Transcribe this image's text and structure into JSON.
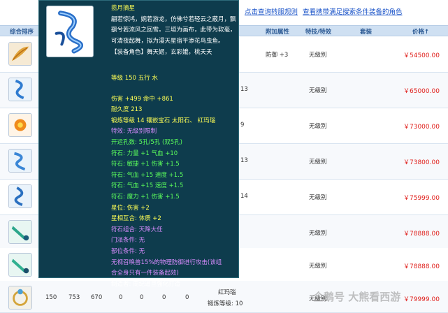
{
  "toplinks": [
    "点击查询转服规则",
    "查看携带满足搜索条件装备的角色"
  ],
  "header": {
    "col_sort": "综合排序",
    "col_attr": "附加属性",
    "col_skill": "特技/特效",
    "col_set": "套装",
    "col_price": "价格↑"
  },
  "rows": [
    {
      "attr": "防御 +3",
      "mid": "",
      "grade": "无级别",
      "price": "￥54500.00"
    },
    {
      "attr": "",
      "mid": "13",
      "grade": "无级别",
      "price": "￥65000.00"
    },
    {
      "attr": "",
      "mid": "9",
      "grade": "无级别",
      "price": "￥73000.00"
    },
    {
      "attr": "",
      "mid": "13",
      "grade": "无级别",
      "price": "￥73800.00"
    },
    {
      "attr": "",
      "mid": "14",
      "grade": "无级别",
      "price": "￥75999.00"
    },
    {
      "attr": "",
      "mid": "",
      "grade": "无级别",
      "price": "￥78888.00"
    },
    {
      "attr": "",
      "mid": "",
      "grade": "无级别",
      "price": "￥78888.00"
    }
  ],
  "last_row": {
    "c1": "150",
    "c2": "753",
    "c3": "670",
    "c4": "0",
    "c5": "0",
    "c6": "0",
    "c7": "0",
    "gem": "红玛瑙",
    "forge": "锻炼等级: 10",
    "grade": "无级别",
    "price": "￥79999.00"
  },
  "tooltip": {
    "name": "揽月摘星",
    "desc": "翩若惊鸿，婉若游龙，仿佛兮若轻云之蔽月，飘飖兮若流风之回雪。三垣为画布，此带为软毫，可清夜起舞，拟为漫天星宿平添花鸟虫鱼。",
    "roles": "【装备角色】舞天姬，玄彩娥，桃夭夭",
    "level": "等级 150 五行 水",
    "lines": [
      {
        "text": "伤害 +499 命中 +861",
        "c": "y"
      },
      {
        "text": "耐久度 213",
        "c": "y"
      },
      {
        "text": "锻炼等级 14 镶嵌宝石 太阳石、 红玛瑙",
        "c": "y"
      },
      {
        "text": "特效: 无级别限制",
        "c": "p"
      },
      {
        "text": "开运孔数: 5孔/5孔 (双5孔)",
        "c": "g"
      },
      {
        "text": "符石: 力量 +1 气血 +10",
        "c": "g"
      },
      {
        "text": "符石: 敏捷 +1 伤害 +1.5",
        "c": "g"
      },
      {
        "text": "符石: 气血 +15 速度 +1.5",
        "c": "g"
      },
      {
        "text": "符石: 气血 +15 速度 +1.5",
        "c": "g"
      },
      {
        "text": "符石: 魔力 +1 伤害 +1.5",
        "c": "g"
      },
      {
        "text": "星位: 伤害 +2",
        "c": "y"
      },
      {
        "text": "星相互合: 体质 +2",
        "c": "y"
      },
      {
        "text": "符石组合: 天降大任",
        "c": "p"
      },
      {
        "text": "门派条件: 无",
        "c": "p"
      },
      {
        "text": "部位条件: 无",
        "c": "p"
      },
      {
        "text": "无视召唤兽15%的物理防御进行攻击(该组",
        "c": "p"
      },
      {
        "text": "合全身只有一件装备起效)",
        "c": "p"
      },
      {
        "text": "制造者: 周纪道旦强化打造",
        "c": "w"
      }
    ]
  },
  "watermark": "企鹅号 大熊看西游",
  "colors": {
    "header_bg": "#cfe0f2",
    "tooltip_bg": "#0e3c4d",
    "price": "#e0201c",
    "link": "#1a53c8"
  }
}
